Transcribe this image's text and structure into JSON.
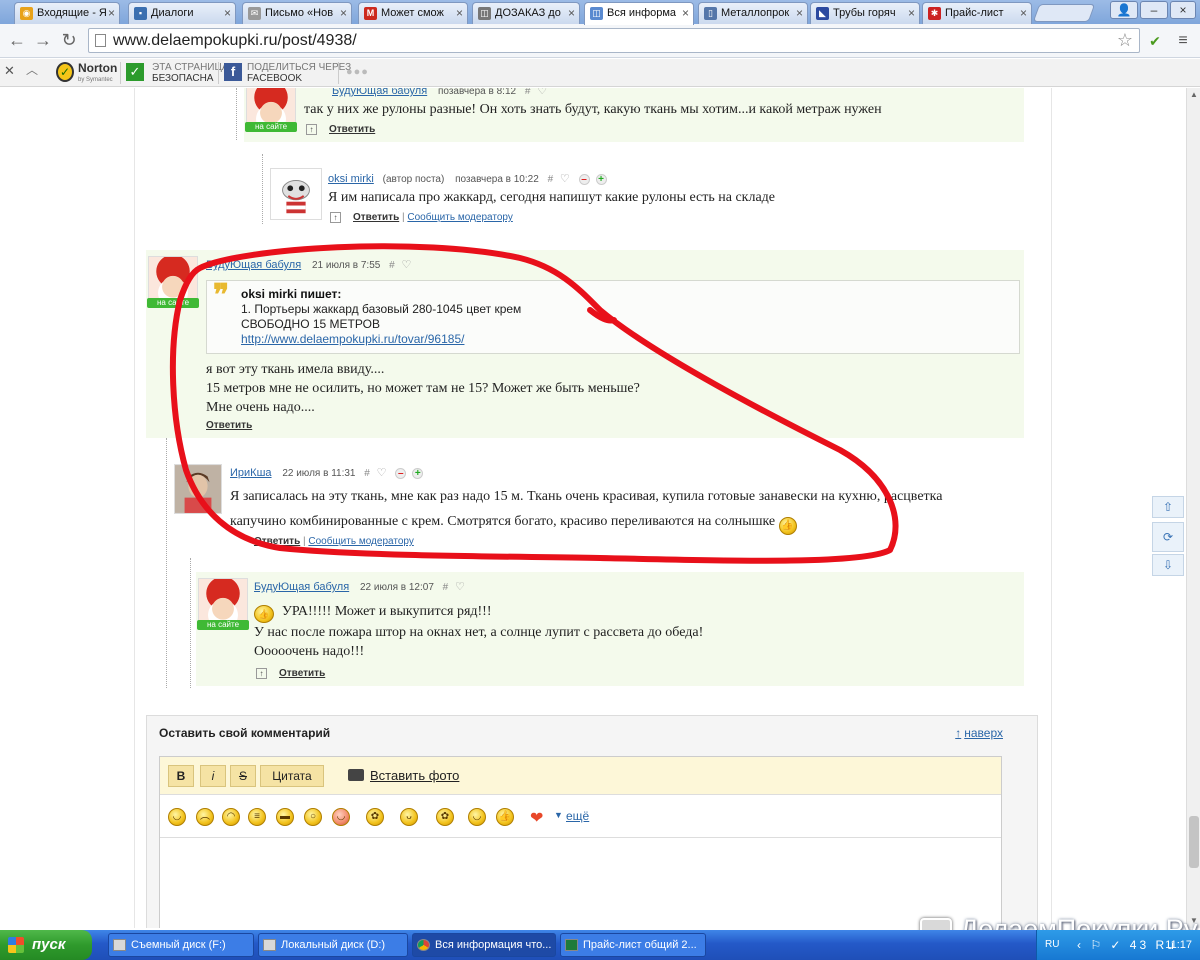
{
  "tabs": [
    {
      "label": "Входящие - Я",
      "color": "#e8a21a",
      "glyph": "◉"
    },
    {
      "label": "Диалоги",
      "color": "#3a6fb0",
      "glyph": "▪"
    },
    {
      "label": "Письмо «Нов",
      "color": "#999999",
      "glyph": "✉"
    },
    {
      "label": "Может смож",
      "color": "#cc2a1e",
      "glyph": "M"
    },
    {
      "label": "ДОЗАКАЗ до",
      "color": "#777777",
      "glyph": "◫"
    },
    {
      "label": "Вся информа",
      "color": "#5a8ad0",
      "glyph": "◫",
      "active": true
    },
    {
      "label": "Металлопрок",
      "color": "#5577aa",
      "glyph": "▯"
    },
    {
      "label": "Трубы горяч",
      "color": "#2c4aa0",
      "glyph": "◣"
    },
    {
      "label": "Прайс-лист",
      "color": "#cc2222",
      "glyph": "✱"
    }
  ],
  "address": {
    "url": "www.delaempokupki.ru/post/4938/"
  },
  "norton": {
    "brand": "Norton",
    "brand_sub": "by Symantec",
    "safe_line1": "ЭТА СТРАНИЦА",
    "safe_line2": "БЕЗОПАСНА",
    "share_line1": "ПОДЕЛИТЬСЯ ЧЕРЕЗ",
    "share_line2": "FACEBOOK",
    "more": "●●●"
  },
  "comments": [
    {
      "id": "c1",
      "author": "БудуЮщая бабуля",
      "time": "позавчера в 8:12",
      "onsite": "на сайте",
      "lines": [
        "так у них же рулоны разные! Он хоть знать будут, какую ткань мы хотим...и какой метраж нужен"
      ],
      "reply": "Ответить"
    },
    {
      "id": "c2",
      "author": "oksi mirki",
      "author_note": "(автор поста)",
      "time": "позавчера в 10:22",
      "lines": [
        "Я им написала про жаккард, сегодня напишут какие рулоны есть на складе"
      ],
      "reply": "Ответить",
      "report": "Сообщить модератору"
    },
    {
      "id": "c3",
      "author": "БудуЮщая бабуля",
      "time": "21 июля в 7:55",
      "onsite": "на сайте",
      "quote": {
        "author": "oksi mirki пишет:",
        "lines": [
          "1. Портьеры жаккард базовый 280-1045 цвет крем",
          "СВОБОДНО 15 МЕТРОВ"
        ],
        "link": "http://www.delaempokupki.ru/tovar/96185/"
      },
      "lines": [
        "я вот эту ткань имела ввиду....",
        "15 метров мне не осилить, но может там не 15? Может же быть меньше?",
        "Мне очень надо...."
      ],
      "reply": "Ответить"
    },
    {
      "id": "c4",
      "author": "ИриКша",
      "time": "22 июля в 11:31",
      "lines": [
        "Я записалась на эту ткань, мне как раз надо 15 м. Ткань очень красивая, купила готовые занавески на кухню, расцветка",
        "капучино комбинированные с крем. Смотрятся богато, красиво переливаются на солнышке"
      ],
      "reply": "Ответить",
      "report": "Сообщить модератору"
    },
    {
      "id": "c5",
      "author": "БудуЮщая бабуля",
      "time": "22 июля в 12:07",
      "onsite": "на сайте",
      "lines": [
        "УРА!!!!! Может и выкупится ряд!!!",
        "У нас после пожара штор на окнах нет, а солнце лупит с рассвета до обеда!",
        "Ооооочень надо!!!"
      ],
      "reply": "Ответить"
    }
  ],
  "form": {
    "title": "Оставить свой комментарий",
    "totop": "наверх",
    "bold": "B",
    "italic": "i",
    "strike": "S",
    "quote": "Цитата",
    "photo": "Вставить фото",
    "more": "ещё"
  },
  "taskbar": {
    "start": "пуск",
    "tasks": [
      "Съемный диск (F:)",
      "Локальный диск (D:)",
      "Вся информация что...",
      "Прайс-лист общий 2..."
    ],
    "lang": "RU",
    "tray_icons": "‹ ⚐ ✓ 43 Ru",
    "clock": "11:17"
  },
  "watermark": "ДелаемПокупки.Ру",
  "colors": {
    "annotation": "#e8101a",
    "comment_bg": "#f4faec",
    "link": "#2a66a8",
    "onsite": "#3fb935"
  }
}
